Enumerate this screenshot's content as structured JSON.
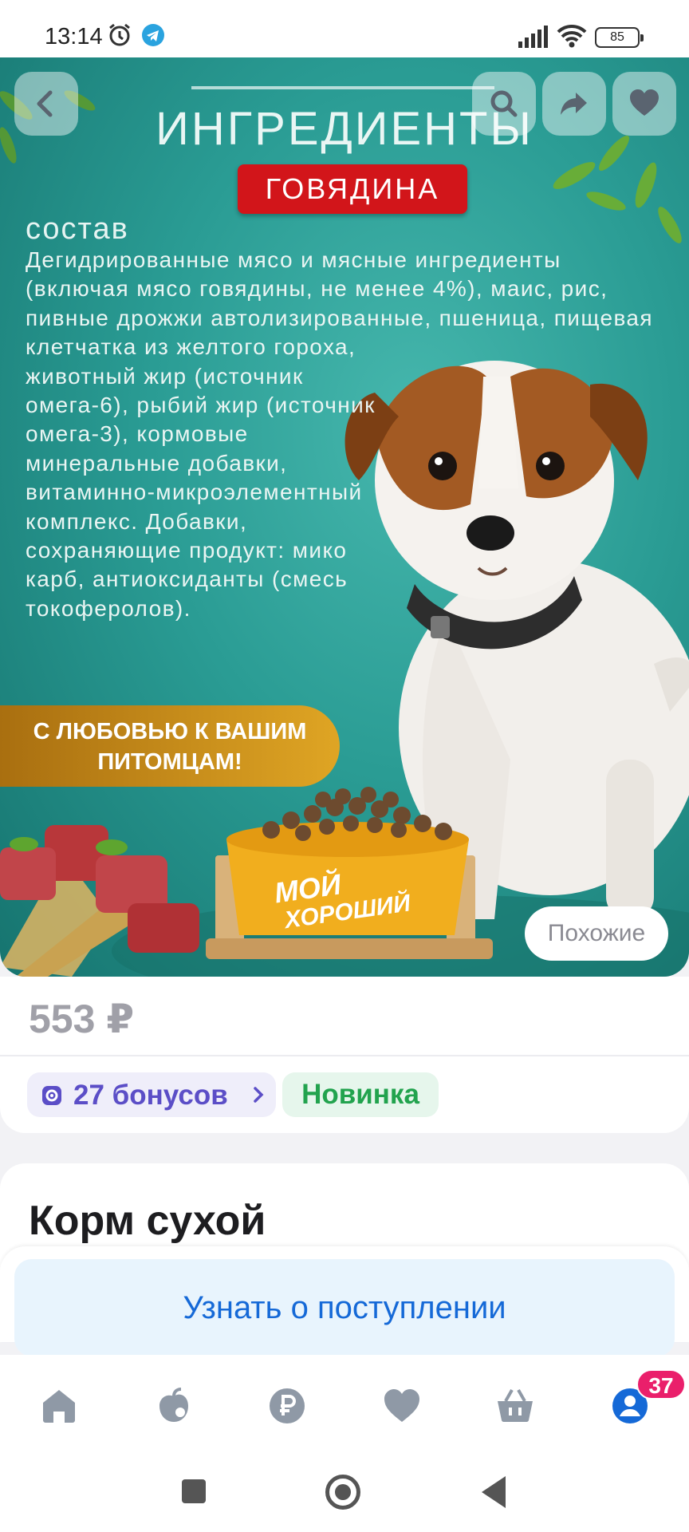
{
  "status_bar": {
    "time": "13:14",
    "battery": "85",
    "icons": [
      "alarm-icon",
      "telegram-icon",
      "signal-icon",
      "wifi-icon",
      "battery-icon"
    ]
  },
  "banner": {
    "title": "ИНГРЕДИЕНТЫ",
    "badge": "ГОВЯДИНА",
    "subtitle": "состав",
    "composition_wide": "Дегидрированные мясо и мясные ингредиенты (включая мясо говядины, не менее 4%), маис, рис, пивные дрожжи автолизированные, пшеница, пищевая клетчатка из желтого гороха,",
    "composition_narrow": "животный жир (источник омега-6), рыбий жир (источник омега-3), кормовые минеральные добавки, витаминно-микроэлементный комплекс. Добавки, сохраняющие продукт: мико карб, антиоксиданты (смесь токоферолов).",
    "slogan_line1": "С ЛЮБОВЬЮ К ВАШИМ",
    "slogan_line2": "ПИТОМЦАМ!",
    "bowl_line1": "МОЙ",
    "bowl_line2": "ХОРОШИЙ",
    "colors": {
      "teal": "#2a9c94",
      "badge_red": "#d2151a",
      "slogan_gold": "#dfa524"
    }
  },
  "toolbar": {
    "back_icon": "chevron-left-icon",
    "search_icon": "search-icon",
    "share_icon": "share-icon",
    "favorite_icon": "heart-icon"
  },
  "similar_button": "Похожие",
  "product": {
    "price": "553 ₽",
    "bonus": "27 бонусов",
    "new_badge": "Новинка",
    "title": "Корм сухой"
  },
  "notify_button": "Узнать о поступлении",
  "tabbar": {
    "tabs": [
      "home-icon",
      "catalog-icon",
      "payments-icon",
      "favorites-icon",
      "cart-icon",
      "profile-icon"
    ],
    "cart_count": "37"
  },
  "accent_color": "#1569d7"
}
